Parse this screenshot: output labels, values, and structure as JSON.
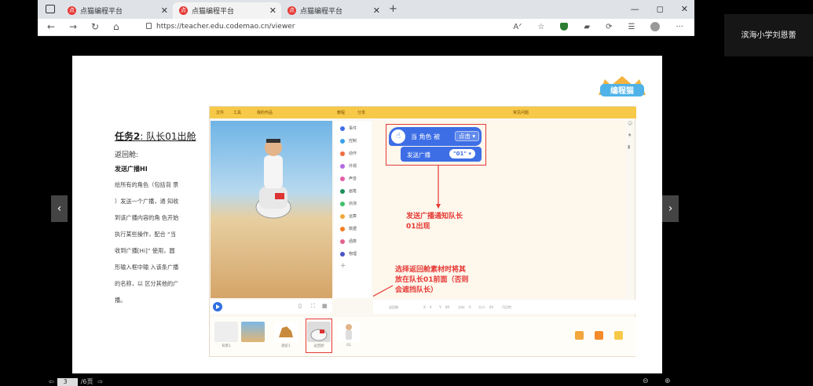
{
  "browser": {
    "tabs": [
      {
        "label": "点猫编程平台",
        "favicon": "点"
      },
      {
        "label": "点猫编程平台",
        "favicon": "点"
      },
      {
        "label": "点猫编程平台",
        "favicon": "点"
      }
    ],
    "new_tab": "+",
    "url": "https://teacher.edu.codemao.cn/viewer",
    "controls": {
      "minimize": "—",
      "restore": "◻",
      "close": "✕"
    }
  },
  "user": {
    "name": "滨海小学刘恩蕾"
  },
  "slide": {
    "task_title_prefix": "任务2",
    "task_title_suffix": ": 队长01出舱",
    "return_cabin": "返回舱:",
    "broadcast_heading": "发送广播HI",
    "description_lines": [
      "给所有的角色（包括背 景",
      "）发送一个广播，通 知收",
      "到该广播内容的角 色开始",
      "执行某些操作，配合 “当",
      "收到广播[Hi]” 使用，圆",
      "形输入框中输 入该条广播",
      "的名称，以 区分其他的广",
      "播。"
    ],
    "logo_text": "编程猫"
  },
  "editor": {
    "toolbar": {
      "file": "文件",
      "tools": "工具",
      "work": "我的作品",
      "tutorial": "教程",
      "share": "分享",
      "topright": "常见问题"
    },
    "categories": [
      {
        "label": "事件",
        "color": "#3d6ee6"
      },
      {
        "label": "控制",
        "color": "#3aa0e8"
      },
      {
        "label": "动作",
        "color": "#f06b3d"
      },
      {
        "label": "外观",
        "color": "#b36ae2"
      },
      {
        "label": "声音",
        "color": "#e65ca8"
      },
      {
        "label": "画笔",
        "color": "#1c8f5a"
      },
      {
        "label": "侦测",
        "color": "#3ec16a"
      },
      {
        "label": "运算",
        "color": "#f3a63a"
      },
      {
        "label": "数据",
        "color": "#f57c1f"
      },
      {
        "label": "函数",
        "color": "#e2628f"
      },
      {
        "label": "物理",
        "color": "#4a55c7"
      }
    ],
    "block_when": "当 角色 被",
    "block_when_option": "点击",
    "block_broadcast": "发送广播",
    "block_broadcast_value": "\"01\"",
    "annotation_1": [
      "发送广播通知队长",
      "01出现"
    ],
    "annotation_2": [
      "选择返回舱素材时将其",
      "放在队长01前面（否则",
      "会遮挡队长）"
    ],
    "sprites": [
      {
        "label": "背景1",
        "color": "#eee"
      },
      {
        "label": "",
        "color": "#e7b377"
      },
      {
        "label": "骆驼1",
        "color": "#fff"
      },
      {
        "label": "返回舱",
        "color": "#ddd"
      },
      {
        "label": "01",
        "color": "#fff"
      }
    ],
    "bottom_info": [
      "返回舱",
      "X:",
      "4",
      "Y:",
      "89",
      "方向:",
      "0",
      "大小:",
      "64",
      "可见性:"
    ]
  },
  "pager": {
    "current": "3",
    "total": "/6页",
    "prev": "⇦",
    "next": "⇨"
  },
  "zoom": {
    "out": "⊖",
    "in": "⊕"
  },
  "nav": {
    "prev": "‹",
    "next": "›"
  }
}
